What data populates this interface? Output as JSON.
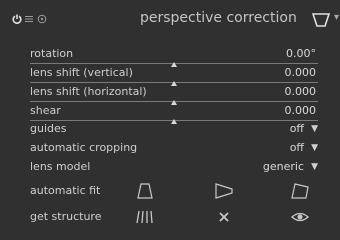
{
  "header": {
    "title": "perspective correction",
    "icons": [
      "power-icon",
      "presets-icon",
      "reset-icon",
      "module-shape-icon",
      "chevron-down-icon"
    ]
  },
  "sliders": [
    {
      "label": "rotation",
      "value": "0.00°"
    },
    {
      "label": "lens shift (vertical)",
      "value": "0.000"
    },
    {
      "label": "lens shift (horizontal)",
      "value": "0.000"
    },
    {
      "label": "shear",
      "value": "0.000"
    }
  ],
  "dropdowns": [
    {
      "label": "guides",
      "value": "off"
    },
    {
      "label": "automatic cropping",
      "value": "off"
    },
    {
      "label": "lens model",
      "value": "generic"
    }
  ],
  "automatic_fit": {
    "label": "automatic fit",
    "buttons": [
      "fit-vertical-icon",
      "fit-horizontal-icon",
      "fit-both-icon"
    ]
  },
  "get_structure": {
    "label": "get structure",
    "buttons": [
      "detect-lines-icon",
      "clear-structure-icon",
      "display-structure-icon"
    ]
  },
  "colors": {
    "background": "#303030",
    "text": "#cfcfcf",
    "track": "#7a7a7a"
  }
}
